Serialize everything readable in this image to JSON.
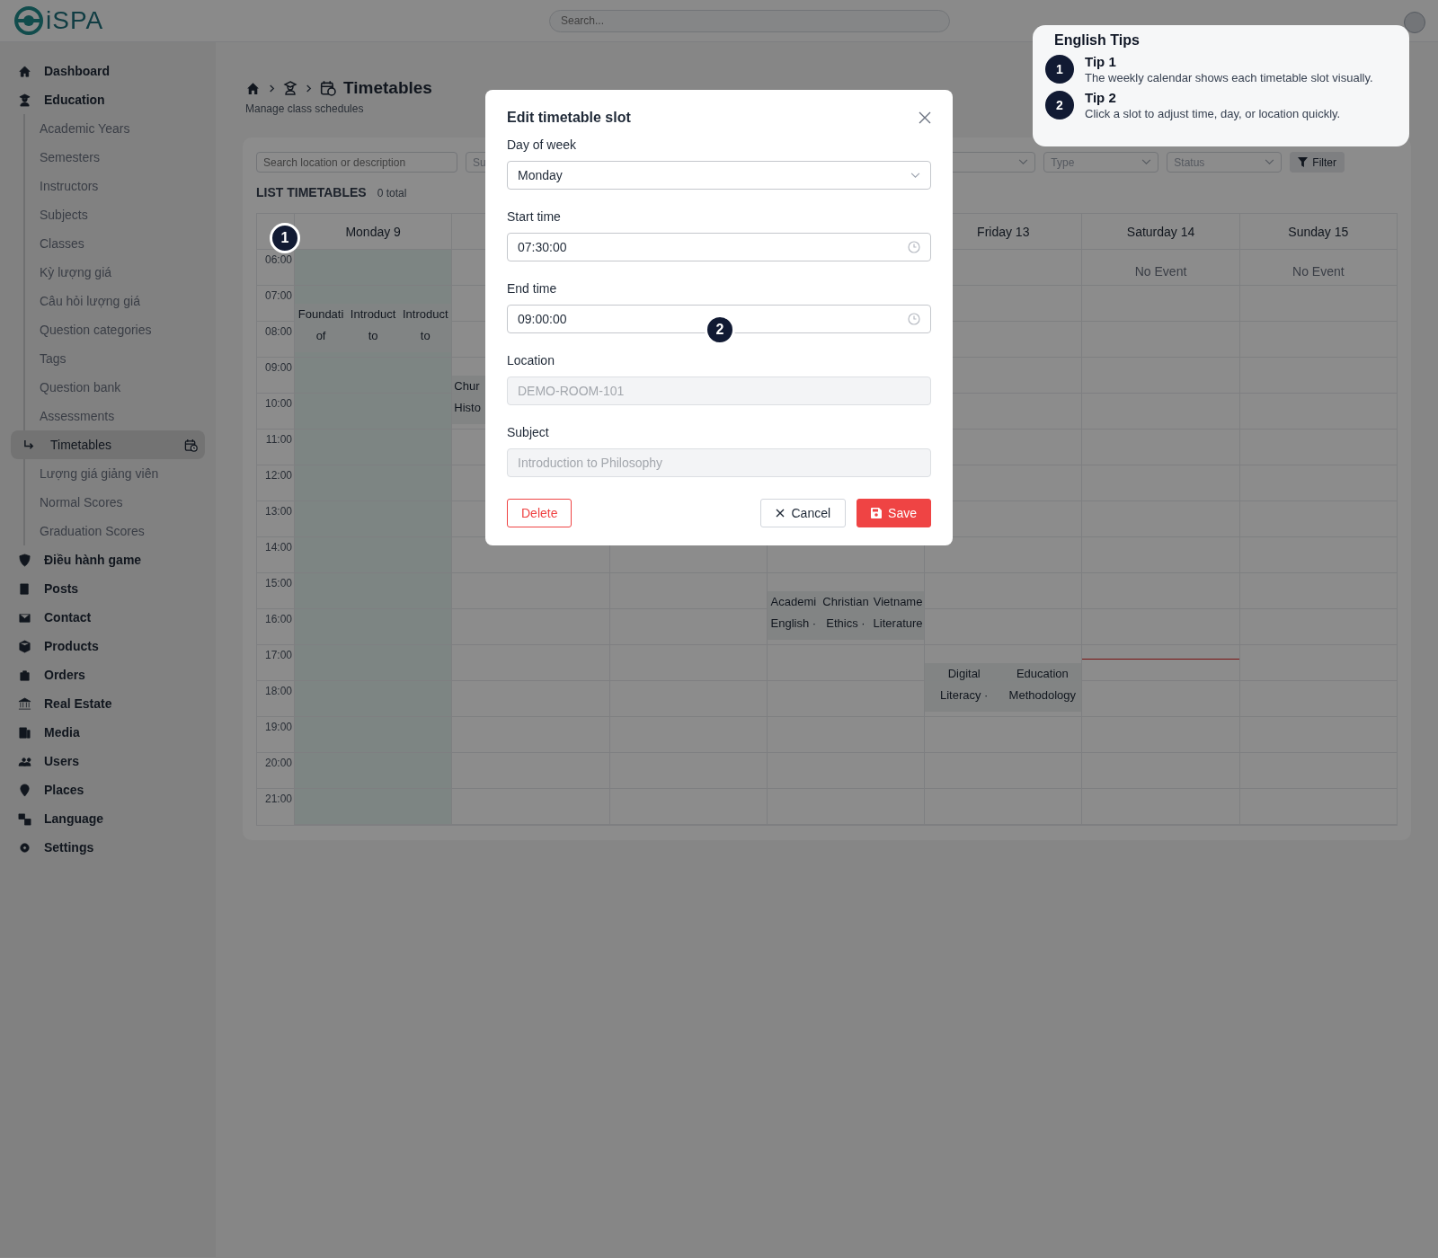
{
  "header": {
    "logo_text": "iSPA",
    "search": {
      "placeholder": "Search..."
    }
  },
  "sidebar": {
    "items": [
      {
        "label": "Dashboard",
        "selected": false
      },
      {
        "label": "Education",
        "selected": false,
        "children": [
          {
            "label": "Academic Years",
            "selected": false
          },
          {
            "label": "Semesters",
            "selected": false
          },
          {
            "label": "Instructors",
            "selected": false
          },
          {
            "label": "Subjects",
            "selected": false
          },
          {
            "label": "Classes",
            "selected": false
          },
          {
            "label": "Kỳ lượng giá",
            "selected": false
          },
          {
            "label": "Câu hỏi lượng giá",
            "selected": false
          },
          {
            "label": "Question categories",
            "selected": false
          },
          {
            "label": "Tags",
            "selected": false
          },
          {
            "label": "Question bank",
            "selected": false
          },
          {
            "label": "Assessments",
            "selected": false
          },
          {
            "label": "Timetables",
            "selected": true
          },
          {
            "label": "Lượng giá giảng viên",
            "selected": false
          },
          {
            "label": "Normal Scores",
            "selected": false
          },
          {
            "label": "Graduation Scores",
            "selected": false
          }
        ]
      },
      {
        "label": "Điều hành game",
        "selected": false
      },
      {
        "label": "Posts",
        "selected": false
      },
      {
        "label": "Contact",
        "selected": false
      },
      {
        "label": "Products",
        "selected": false
      },
      {
        "label": "Orders",
        "selected": false
      },
      {
        "label": "Real Estate",
        "selected": false
      },
      {
        "label": "Media",
        "selected": false
      },
      {
        "label": "Users",
        "selected": false
      },
      {
        "label": "Places",
        "selected": false
      },
      {
        "label": "Language",
        "selected": false
      },
      {
        "label": "Settings",
        "selected": false
      }
    ]
  },
  "page": {
    "title": "Timetables",
    "subtitle": "Manage class schedules"
  },
  "filters": {
    "search": {
      "placeholder": "Search location or description"
    },
    "subject": {
      "placeholder": "Su"
    },
    "type": {
      "placeholder": "Type"
    },
    "status": {
      "placeholder": "Status"
    },
    "filter_button": "Filter"
  },
  "list": {
    "title": "LIST TIMETABLES",
    "count": "0 total"
  },
  "calendar": {
    "days": [
      {
        "label": "Monday 9",
        "today": true,
        "now_line": false
      },
      {
        "today": false,
        "now_line": false
      },
      {
        "today": false,
        "now_line": false
      },
      {
        "today": false,
        "now_line": false
      },
      {
        "label": "Friday 13",
        "today": false,
        "now_line": false
      },
      {
        "label": "Saturday 14",
        "today": false,
        "now_line": true,
        "empty_text": "No Event"
      },
      {
        "label": "Sunday 15",
        "today": false,
        "now_line": false,
        "empty_text": "No Event"
      }
    ],
    "rows": [
      {
        "time": "06:00",
        "cells": [
          [],
          [],
          [],
          [],
          [],
          [],
          []
        ]
      },
      {
        "time": "07:00",
        "cells": [
          [
            {
              "lines": [
                "Foundati",
                "of"
              ]
            },
            {
              "lines": [
                "Introduct",
                "to"
              ]
            },
            {
              "lines": [
                "Introduct",
                "to"
              ]
            }
          ],
          [],
          [],
          [],
          [],
          [],
          []
        ]
      },
      {
        "time": "08:00",
        "cells": [
          [],
          [],
          [],
          [],
          [],
          [],
          []
        ]
      },
      {
        "time": "09:00",
        "cells": [
          [],
          [
            {
              "lines": [
                "Chur",
                "Histo"
              ]
            }
          ],
          [],
          [],
          [],
          [],
          []
        ]
      },
      {
        "time": "10:00",
        "cells": [
          [],
          [],
          [],
          [],
          [],
          [],
          []
        ]
      },
      {
        "time": "11:00",
        "cells": [
          [],
          [],
          [],
          [],
          [],
          [],
          []
        ]
      },
      {
        "time": "12:00",
        "cells": [
          [],
          [],
          [],
          [],
          [],
          [],
          []
        ]
      },
      {
        "time": "13:00",
        "cells": [
          [],
          [],
          [],
          [],
          [],
          [],
          []
        ]
      },
      {
        "time": "14:00",
        "cells": [
          [],
          [],
          [],
          [],
          [],
          [],
          []
        ]
      },
      {
        "time": "15:00",
        "cells": [
          [],
          [],
          [],
          [
            {
              "lines": [
                "Academi",
                "English ·"
              ]
            },
            {
              "lines": [
                "Christian",
                "Ethics ·"
              ]
            },
            {
              "lines": [
                "Vietname",
                "Literature"
              ]
            }
          ],
          [],
          [],
          []
        ]
      },
      {
        "time": "16:00",
        "cells": [
          [],
          [],
          [],
          [],
          [],
          [],
          []
        ]
      },
      {
        "time": "17:00",
        "cells": [
          [],
          [],
          [],
          [],
          [
            {
              "lines": [
                "Digital",
                "Literacy ·"
              ]
            },
            {
              "lines": [
                "Education",
                "Methodology"
              ]
            }
          ],
          [],
          []
        ]
      },
      {
        "time": "18:00",
        "cells": [
          [],
          [],
          [],
          [],
          [],
          [],
          []
        ]
      },
      {
        "time": "19:00",
        "cells": [
          [],
          [],
          [],
          [],
          [],
          [],
          []
        ]
      },
      {
        "time": "20:00",
        "cells": [
          [],
          [],
          [],
          [],
          [],
          [],
          []
        ]
      },
      {
        "time": "21:00",
        "cells": [
          [],
          [],
          [],
          [],
          [],
          [],
          []
        ]
      }
    ]
  },
  "modal": {
    "title": "Edit timetable slot",
    "fields": [
      {
        "label": "Day of week",
        "kind": "select",
        "value": "Monday",
        "disabled": false
      },
      {
        "label": "Start time",
        "kind": "time",
        "value": "07:30:00",
        "disabled": false
      },
      {
        "label": "End time",
        "kind": "time",
        "value": "09:00:00",
        "disabled": false
      },
      {
        "label": "Location",
        "kind": "text",
        "value": "DEMO-ROOM-101",
        "disabled": true
      },
      {
        "label": "Subject",
        "kind": "text",
        "value": "Introduction to Philosophy",
        "disabled": true
      }
    ],
    "delete_button": "Delete",
    "cancel_button": "Cancel",
    "save_button": "Save"
  },
  "tips": {
    "title": "English Tips",
    "items": [
      {
        "number": "1",
        "title": "Tip 1",
        "text": "The weekly calendar shows each timetable slot visually."
      },
      {
        "number": "2",
        "title": "Tip 2",
        "text": "Click a slot to adjust time, day, or location quickly."
      }
    ]
  },
  "tour_markers": [
    {
      "number": "1"
    },
    {
      "number": "2"
    }
  ]
}
